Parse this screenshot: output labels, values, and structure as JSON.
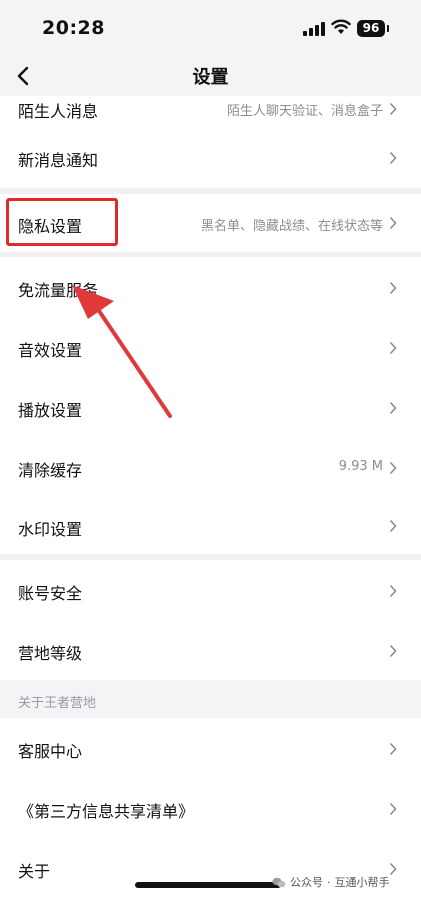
{
  "status_bar": {
    "time": "20:28",
    "battery": "96"
  },
  "header": {
    "title": "设置"
  },
  "rows": [
    {
      "label": "陌生人消息",
      "value": "陌生人聊天验证、消息盒子"
    },
    {
      "label": "新消息通知",
      "value": ""
    },
    {
      "label": "隐私设置",
      "value": "黑名单、隐藏战绩、在线状态等"
    },
    {
      "label": "免流量服务",
      "value": ""
    },
    {
      "label": "音效设置",
      "value": ""
    },
    {
      "label": "播放设置",
      "value": ""
    },
    {
      "label": "清除缓存",
      "value": "9.93 M"
    },
    {
      "label": "水印设置",
      "value": ""
    },
    {
      "label": "账号安全",
      "value": ""
    },
    {
      "label": "营地等级",
      "value": ""
    },
    {
      "label": "客服中心",
      "value": ""
    },
    {
      "label": "《第三方信息共享清单》",
      "value": ""
    },
    {
      "label": "关于",
      "value": ""
    }
  ],
  "section_about": {
    "title": "关于王者营地"
  },
  "watermark": {
    "prefix": "公众号",
    "separator": "·",
    "name": "互通小帮手"
  },
  "colors": {
    "highlight": "#e02b2b",
    "arrow": "#e0393a",
    "background": "#f4f4f6",
    "row": "#ffffff"
  }
}
